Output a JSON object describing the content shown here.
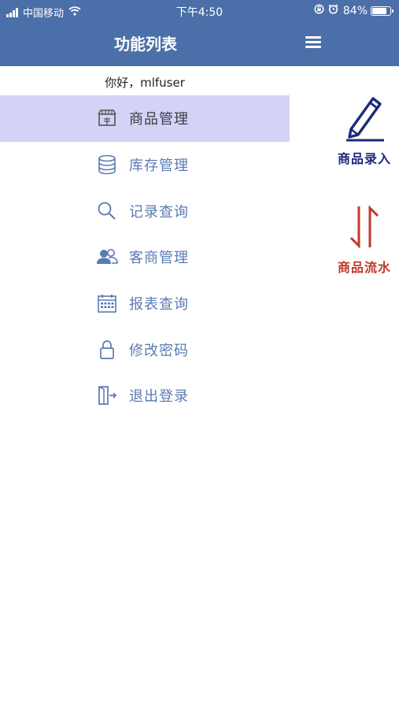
{
  "status_bar": {
    "carrier": "中国移动",
    "time": "下午4:50",
    "battery": "84%",
    "battery_level": 0.84,
    "icons": [
      "signal-icon",
      "wifi-icon",
      "orientation-lock-icon",
      "alarm-icon",
      "battery-icon"
    ]
  },
  "header": {
    "title": "功能列表",
    "menu_icon": "hamburger-icon"
  },
  "drawer": {
    "greeting": "你好，mlfuser",
    "items": [
      {
        "label": "商品管理",
        "icon": "store-icon",
        "active": true
      },
      {
        "label": "库存管理",
        "icon": "database-icon",
        "active": false
      },
      {
        "label": "记录查询",
        "icon": "search-icon",
        "active": false
      },
      {
        "label": "客商管理",
        "icon": "users-icon",
        "active": false
      },
      {
        "label": "报表查询",
        "icon": "calendar-icon",
        "active": false
      },
      {
        "label": "修改密码",
        "icon": "lock-icon",
        "active": false
      },
      {
        "label": "退出登录",
        "icon": "logout-icon",
        "active": false
      }
    ]
  },
  "panel": {
    "entry": {
      "label": "商品录入",
      "icon": "pencil-icon",
      "color": "#1c2a7a"
    },
    "flow": {
      "label": "商品流水",
      "icon": "swap-arrows-icon",
      "color": "#c0392b"
    }
  },
  "colors": {
    "header_bg": "#4b6fa8",
    "active_item_bg": "#d4d2f7",
    "menu_text": "#5a7bb2"
  }
}
